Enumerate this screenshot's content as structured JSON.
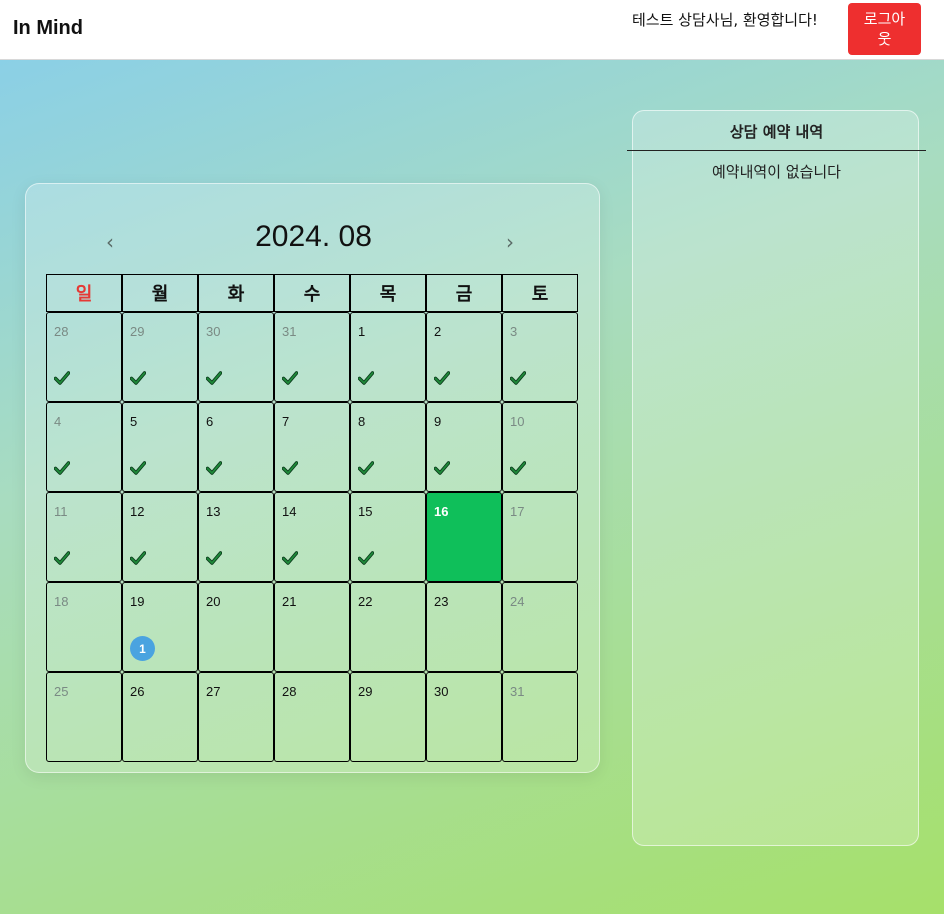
{
  "header": {
    "logo": "In Mind",
    "welcome": "테스트 상담사님, 환영합니다!",
    "logout_label": "로그아웃"
  },
  "calendar": {
    "title": "2024. 08",
    "prev_icon": "chevron-left-icon",
    "next_icon": "chevron-right-icon",
    "prev_glyph": "‹",
    "next_glyph": "›",
    "weekdays": [
      "일",
      "월",
      "화",
      "수",
      "목",
      "금",
      "토"
    ],
    "weeks": [
      [
        {
          "day": "28",
          "dim": true,
          "check": true
        },
        {
          "day": "29",
          "dim": true,
          "check": true
        },
        {
          "day": "30",
          "dim": true,
          "check": true
        },
        {
          "day": "31",
          "dim": true,
          "check": true
        },
        {
          "day": "1",
          "dim": false,
          "check": true
        },
        {
          "day": "2",
          "dim": false,
          "check": true
        },
        {
          "day": "3",
          "dim": true,
          "check": true
        }
      ],
      [
        {
          "day": "4",
          "dim": true,
          "check": true
        },
        {
          "day": "5",
          "dim": false,
          "check": true
        },
        {
          "day": "6",
          "dim": false,
          "check": true
        },
        {
          "day": "7",
          "dim": false,
          "check": true
        },
        {
          "day": "8",
          "dim": false,
          "check": true
        },
        {
          "day": "9",
          "dim": false,
          "check": true
        },
        {
          "day": "10",
          "dim": true,
          "check": true
        }
      ],
      [
        {
          "day": "11",
          "dim": true,
          "check": true
        },
        {
          "day": "12",
          "dim": false,
          "check": true
        },
        {
          "day": "13",
          "dim": false,
          "check": true
        },
        {
          "day": "14",
          "dim": false,
          "check": true
        },
        {
          "day": "15",
          "dim": false,
          "check": true
        },
        {
          "day": "16",
          "dim": false,
          "check": false,
          "today": true
        },
        {
          "day": "17",
          "dim": true,
          "check": false
        }
      ],
      [
        {
          "day": "18",
          "dim": true,
          "check": false
        },
        {
          "day": "19",
          "dim": false,
          "check": false,
          "badge": "1"
        },
        {
          "day": "20",
          "dim": false,
          "check": false
        },
        {
          "day": "21",
          "dim": false,
          "check": false
        },
        {
          "day": "22",
          "dim": false,
          "check": false
        },
        {
          "day": "23",
          "dim": false,
          "check": false
        },
        {
          "day": "24",
          "dim": true,
          "check": false
        }
      ],
      [
        {
          "day": "25",
          "dim": true,
          "check": false
        },
        {
          "day": "26",
          "dim": false,
          "check": false
        },
        {
          "day": "27",
          "dim": false,
          "check": false
        },
        {
          "day": "28",
          "dim": false,
          "check": false
        },
        {
          "day": "29",
          "dim": false,
          "check": false
        },
        {
          "day": "30",
          "dim": false,
          "check": false
        },
        {
          "day": "31",
          "dim": true,
          "check": false
        }
      ]
    ],
    "colors": {
      "today": "#0fbf5a",
      "sunday": "#e53935",
      "badge": "#4aa3e0",
      "check": "#1f8a3a"
    }
  },
  "reservations": {
    "title": "상담 예약 내역",
    "empty_message": "예약내역이 없습니다"
  }
}
